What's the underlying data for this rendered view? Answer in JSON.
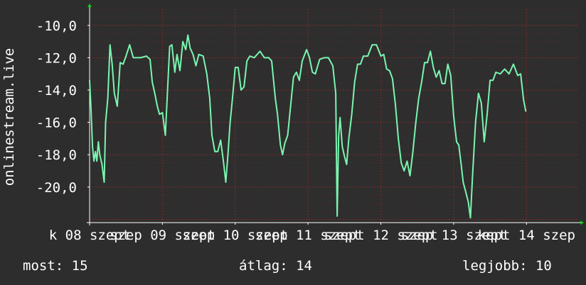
{
  "chart_data": {
    "type": "line",
    "ylabel": "onlinestream.live",
    "ylim": [
      -22.2,
      -9.0
    ],
    "y_ticks": [
      "-10,0",
      "-12,0",
      "-14,0",
      "-16,0",
      "-18,0",
      "-20,0"
    ],
    "y_tick_values": [
      -10,
      -12,
      -14,
      -16,
      -18,
      -20
    ],
    "x_ticks": [
      "k 08 szept",
      "szep 09 szept",
      "szep 10 szept",
      "szep 11 szept",
      "szept 12 szept",
      "szep 13 szept",
      "kept 14 szep"
    ],
    "x_tick_positions": [
      0.0,
      1.0,
      2.0,
      3.0,
      4.0,
      5.0,
      6.0
    ],
    "xlim": [
      0.0,
      6.7
    ],
    "grid": true,
    "colors": {
      "background": "#2d2d2d",
      "plot_background": "#2e2e2e",
      "line": "#7af5b0",
      "grid": "#8a2a2a",
      "axis": "#ffffff",
      "arrow": "#11cc11"
    },
    "series": [
      {
        "values": [
          [
            0.0,
            -13.4
          ],
          [
            0.02,
            -15.2
          ],
          [
            0.04,
            -17.5
          ],
          [
            0.06,
            -18.4
          ],
          [
            0.08,
            -17.8
          ],
          [
            0.1,
            -18.4
          ],
          [
            0.12,
            -17.2
          ],
          [
            0.14,
            -18.0
          ],
          [
            0.17,
            -18.6
          ],
          [
            0.2,
            -19.7
          ],
          [
            0.22,
            -16.0
          ],
          [
            0.25,
            -14.5
          ],
          [
            0.28,
            -11.2
          ],
          [
            0.31,
            -12.4
          ],
          [
            0.34,
            -14.2
          ],
          [
            0.38,
            -15.0
          ],
          [
            0.42,
            -12.3
          ],
          [
            0.46,
            -12.4
          ],
          [
            0.5,
            -11.9
          ],
          [
            0.55,
            -11.2
          ],
          [
            0.6,
            -12.0
          ],
          [
            0.7,
            -12.0
          ],
          [
            0.78,
            -11.9
          ],
          [
            0.83,
            -12.1
          ],
          [
            0.86,
            -13.5
          ],
          [
            0.9,
            -14.3
          ],
          [
            0.93,
            -15.0
          ],
          [
            0.96,
            -15.5
          ],
          [
            1.0,
            -15.4
          ],
          [
            1.04,
            -16.8
          ],
          [
            1.07,
            -14.0
          ],
          [
            1.1,
            -11.3
          ],
          [
            1.13,
            -11.2
          ],
          [
            1.17,
            -12.9
          ],
          [
            1.2,
            -11.8
          ],
          [
            1.24,
            -12.8
          ],
          [
            1.28,
            -11.0
          ],
          [
            1.32,
            -11.5
          ],
          [
            1.35,
            -10.6
          ],
          [
            1.38,
            -11.4
          ],
          [
            1.42,
            -11.8
          ],
          [
            1.46,
            -12.5
          ],
          [
            1.5,
            -11.8
          ],
          [
            1.56,
            -11.9
          ],
          [
            1.61,
            -13.0
          ],
          [
            1.65,
            -14.5
          ],
          [
            1.68,
            -16.8
          ],
          [
            1.72,
            -17.8
          ],
          [
            1.76,
            -17.8
          ],
          [
            1.8,
            -17.1
          ],
          [
            1.84,
            -18.5
          ],
          [
            1.87,
            -19.7
          ],
          [
            1.9,
            -18.0
          ],
          [
            1.93,
            -16.0
          ],
          [
            1.96,
            -14.6
          ],
          [
            2.0,
            -12.6
          ],
          [
            2.04,
            -12.6
          ],
          [
            2.08,
            -14.0
          ],
          [
            2.12,
            -13.8
          ],
          [
            2.16,
            -12.2
          ],
          [
            2.2,
            -11.9
          ],
          [
            2.26,
            -12.0
          ],
          [
            2.34,
            -11.6
          ],
          [
            2.4,
            -12.0
          ],
          [
            2.46,
            -12.0
          ],
          [
            2.5,
            -12.2
          ],
          [
            2.55,
            -14.5
          ],
          [
            2.58,
            -15.5
          ],
          [
            2.62,
            -17.4
          ],
          [
            2.65,
            -18.0
          ],
          [
            2.68,
            -17.3
          ],
          [
            2.72,
            -16.8
          ],
          [
            2.76,
            -15.0
          ],
          [
            2.8,
            -13.2
          ],
          [
            2.84,
            -12.9
          ],
          [
            2.88,
            -13.4
          ],
          [
            2.92,
            -12.2
          ],
          [
            2.98,
            -11.5
          ],
          [
            3.02,
            -12.0
          ],
          [
            3.06,
            -12.9
          ],
          [
            3.1,
            -13.0
          ],
          [
            3.16,
            -12.1
          ],
          [
            3.22,
            -12.0
          ],
          [
            3.28,
            -12.0
          ],
          [
            3.34,
            -12.5
          ],
          [
            3.38,
            -14.2
          ],
          [
            3.4,
            -21.8
          ],
          [
            3.42,
            -16.8
          ],
          [
            3.44,
            -15.7
          ],
          [
            3.47,
            -17.5
          ],
          [
            3.5,
            -18.1
          ],
          [
            3.53,
            -18.6
          ],
          [
            3.56,
            -17.0
          ],
          [
            3.6,
            -15.5
          ],
          [
            3.64,
            -13.5
          ],
          [
            3.68,
            -12.4
          ],
          [
            3.72,
            -12.4
          ],
          [
            3.76,
            -11.9
          ],
          [
            3.82,
            -11.9
          ],
          [
            3.88,
            -11.2
          ],
          [
            3.94,
            -11.2
          ],
          [
            4.0,
            -11.9
          ],
          [
            4.04,
            -11.8
          ],
          [
            4.08,
            -12.7
          ],
          [
            4.12,
            -12.8
          ],
          [
            4.16,
            -13.3
          ],
          [
            4.2,
            -14.9
          ],
          [
            4.24,
            -17.0
          ],
          [
            4.28,
            -18.5
          ],
          [
            4.32,
            -19.0
          ],
          [
            4.36,
            -18.4
          ],
          [
            4.4,
            -19.3
          ],
          [
            4.44,
            -17.8
          ],
          [
            4.48,
            -16.0
          ],
          [
            4.52,
            -14.5
          ],
          [
            4.56,
            -13.5
          ],
          [
            4.6,
            -12.3
          ],
          [
            4.64,
            -12.3
          ],
          [
            4.68,
            -11.6
          ],
          [
            4.72,
            -12.6
          ],
          [
            4.76,
            -13.2
          ],
          [
            4.8,
            -12.8
          ],
          [
            4.84,
            -13.6
          ],
          [
            4.88,
            -13.6
          ],
          [
            4.92,
            -12.4
          ],
          [
            4.96,
            -13.1
          ],
          [
            5.0,
            -15.6
          ],
          [
            5.04,
            -17.2
          ],
          [
            5.07,
            -17.4
          ],
          [
            5.1,
            -18.5
          ],
          [
            5.13,
            -19.7
          ],
          [
            5.16,
            -20.2
          ],
          [
            5.2,
            -20.9
          ],
          [
            5.23,
            -21.9
          ],
          [
            5.26,
            -19.2
          ],
          [
            5.3,
            -16.0
          ],
          [
            5.34,
            -14.2
          ],
          [
            5.38,
            -14.8
          ],
          [
            5.42,
            -17.2
          ],
          [
            5.46,
            -15.5
          ],
          [
            5.5,
            -13.4
          ],
          [
            5.54,
            -13.4
          ],
          [
            5.58,
            -12.9
          ],
          [
            5.64,
            -13.0
          ],
          [
            5.7,
            -12.7
          ],
          [
            5.76,
            -13.0
          ],
          [
            5.82,
            -12.4
          ],
          [
            5.88,
            -13.1
          ],
          [
            5.92,
            -13.0
          ],
          [
            5.96,
            -14.6
          ],
          [
            5.99,
            -15.3
          ]
        ]
      }
    ]
  },
  "footer": {
    "current_label": "most: 15",
    "average_label": "átlag: 14",
    "best_label": "legjobb: 10"
  }
}
